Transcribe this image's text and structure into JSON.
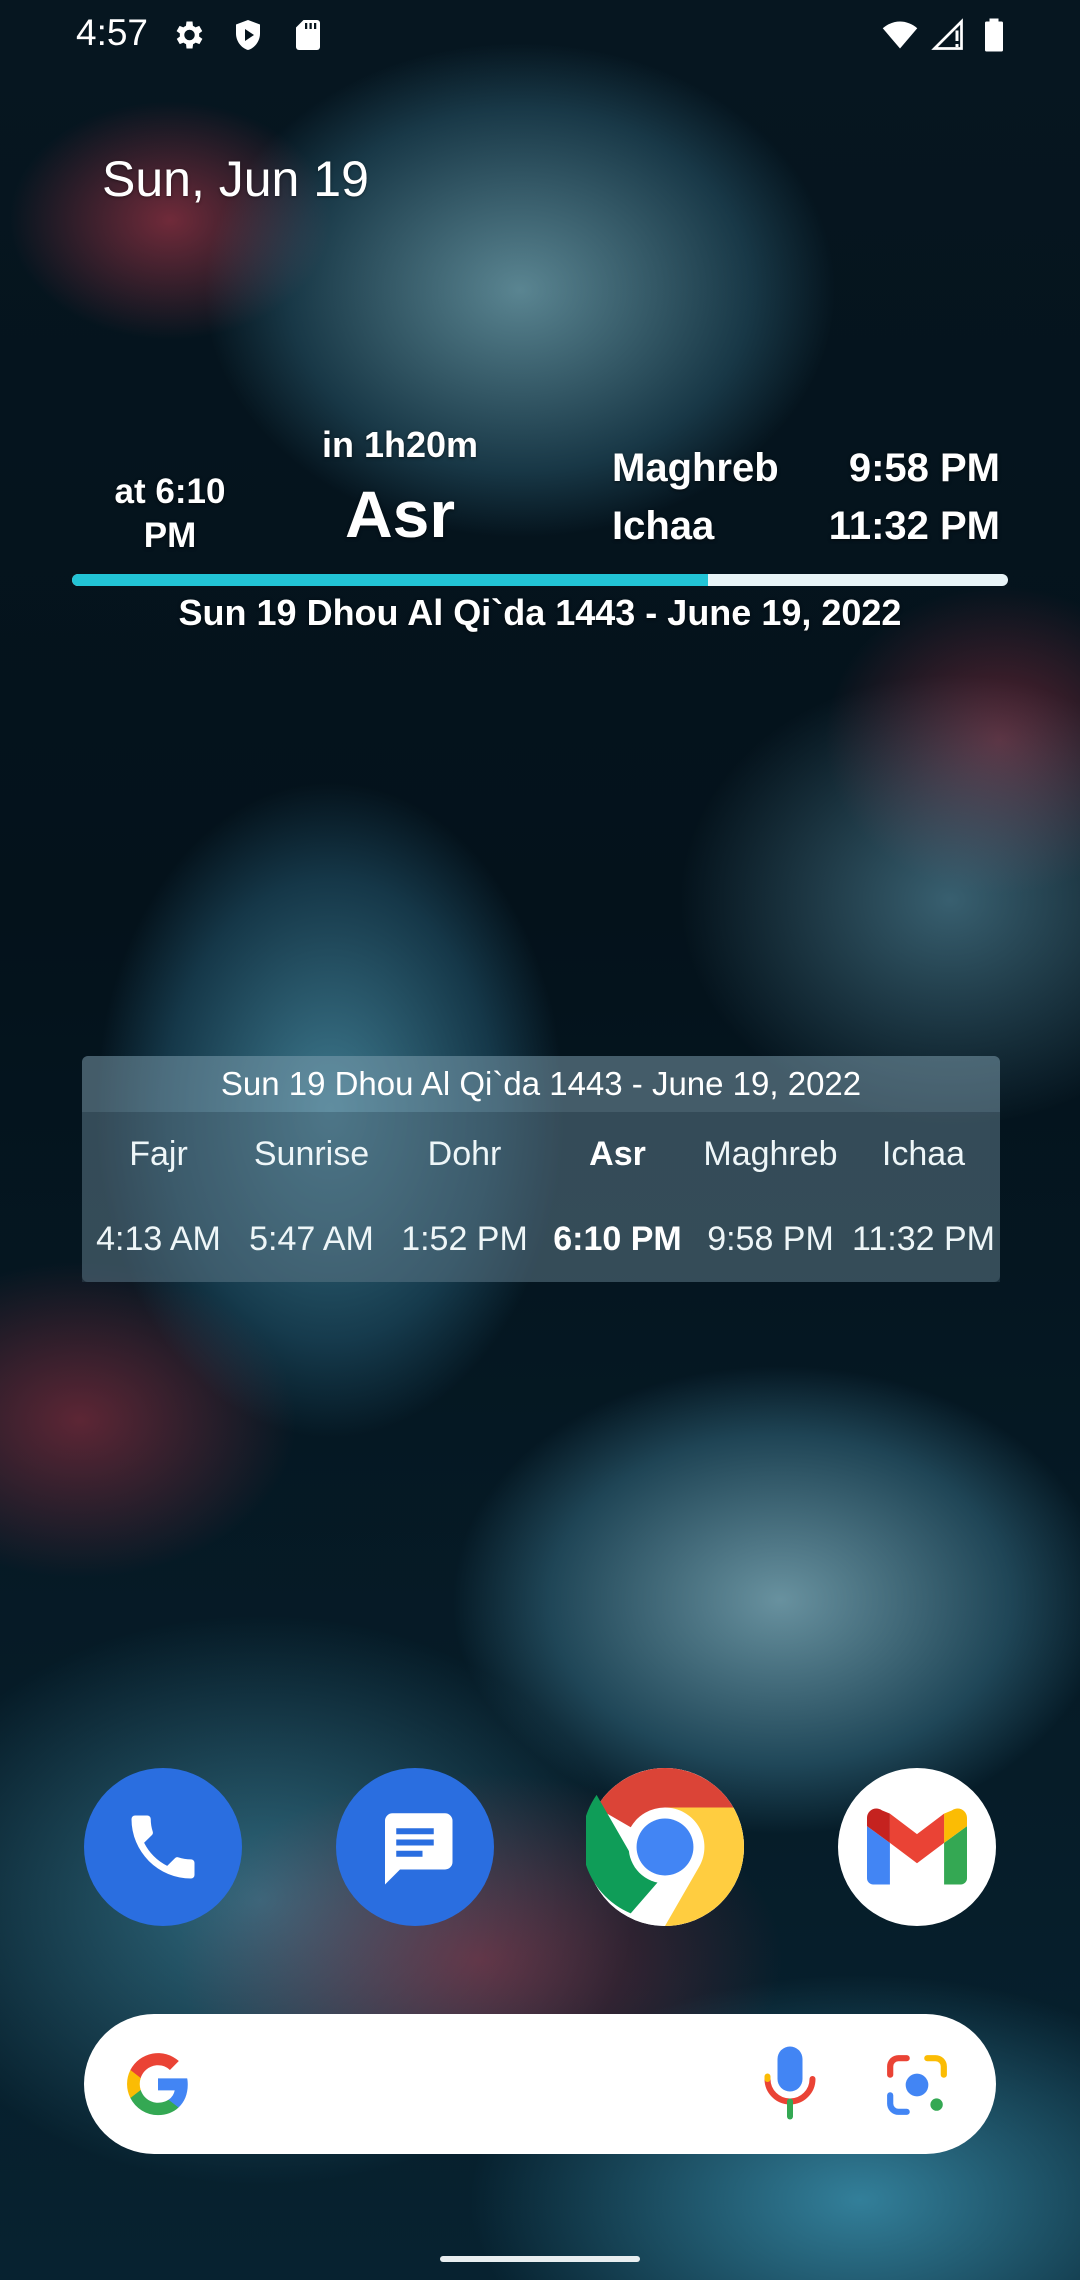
{
  "status_bar": {
    "time": "4:57",
    "left_icons": [
      "settings-icon",
      "shield-play-icon",
      "sd-card-icon"
    ],
    "right_icons": [
      "wifi-icon",
      "cell-signal-alert-icon",
      "battery-icon"
    ]
  },
  "date_widget": {
    "date": "Sun, Jun 19"
  },
  "prayer_widget": {
    "at_time": "at 6:10 PM",
    "countdown": "in 1h20m",
    "current_prayer": "Asr",
    "next": [
      {
        "name": "Maghreb",
        "time": "9:58 PM"
      },
      {
        "name": "Ichaa",
        "time": "11:32 PM"
      }
    ],
    "progress_fraction": 0.68,
    "progress_color": "#22c4d6",
    "hijri_date": "Sun 19 Dhou Al Qi`da 1443 - June 19, 2022"
  },
  "table_widget": {
    "header": "Sun 19 Dhou Al Qi`da 1443 - June 19, 2022",
    "prayers": [
      {
        "name": "Fajr",
        "time": "4:13 AM"
      },
      {
        "name": "Sunrise",
        "time": "5:47 AM"
      },
      {
        "name": "Dohr",
        "time": "1:52 PM"
      },
      {
        "name": "Asr",
        "time": "6:10 PM"
      },
      {
        "name": "Maghreb",
        "time": "9:58 PM"
      },
      {
        "name": "Ichaa",
        "time": "11:32 PM"
      }
    ],
    "active_index": 3
  },
  "dock": {
    "apps": [
      "phone-icon",
      "messages-icon",
      "chrome-icon",
      "gmail-icon"
    ]
  },
  "search_bar": {
    "icons": [
      "google-g-icon",
      "mic-icon",
      "lens-icon"
    ]
  }
}
